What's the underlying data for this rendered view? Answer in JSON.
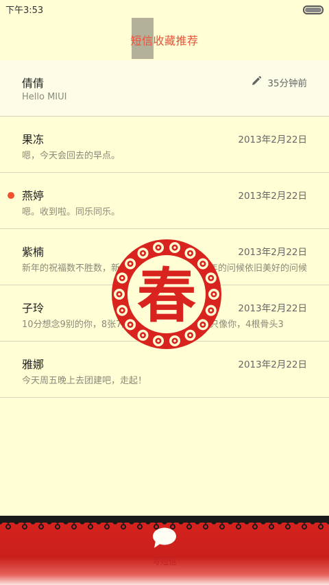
{
  "status_bar": {
    "time": "下午3:53"
  },
  "header": {
    "title": "短信收藏推荐"
  },
  "conversations": [
    {
      "name": "倩倩",
      "snippet": "Hello MIUI",
      "date": "35分钟前",
      "draft": true,
      "unread": false
    },
    {
      "name": "果冻",
      "snippet": "嗯，今天会回去的早点。",
      "date": "2013年2月22日",
      "draft": false,
      "unread": false
    },
    {
      "name": "燕婷",
      "snippet": "嗯。收到啦。同乐同乐。",
      "date": "2013年2月22日",
      "draft": false,
      "unread": true
    },
    {
      "name": "紫楠",
      "snippet": "新年的祝福数不胜数，新年的愿望好多好多，新年的问候依旧美好的问候",
      "date": "2013年2月22日",
      "draft": false,
      "unread": false
    },
    {
      "name": "子玲",
      "snippet": "10分想念9别的你，8张7片7张是你，6只小狗5只像你，4根骨头3",
      "date": "2013年2月22日",
      "draft": false,
      "unread": false
    },
    {
      "name": "雅娜",
      "snippet": "今天周五晚上去团建吧，走起！",
      "date": "2013年2月22日",
      "draft": false,
      "unread": false
    }
  ],
  "stamp": {
    "character": "春",
    "icon": "spring-festival-stamp"
  },
  "bottom_bar": {
    "compose_label": "写短信",
    "compose_icon": "speech-bubble-icon"
  },
  "colors": {
    "background": "#fffed5",
    "accent": "#e8523a",
    "unread": "#f0522f",
    "festive_red": "#d8231f"
  }
}
